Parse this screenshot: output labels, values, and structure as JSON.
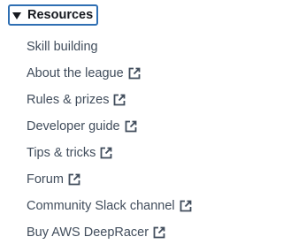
{
  "section": {
    "title": "Resources",
    "expanded": true,
    "caret_icon": "caret-down-icon"
  },
  "links": [
    {
      "label": "Skill building",
      "external": false
    },
    {
      "label": "About the league",
      "external": true
    },
    {
      "label": "Rules & prizes",
      "external": true
    },
    {
      "label": "Developer guide",
      "external": true
    },
    {
      "label": "Tips & tricks",
      "external": true
    },
    {
      "label": "Forum",
      "external": true
    },
    {
      "label": "Community Slack channel",
      "external": true
    },
    {
      "label": "Buy AWS DeepRacer",
      "external": true
    }
  ],
  "external_icon": "external-link-icon",
  "colors": {
    "focus_ring": "#2f6fb3",
    "text_primary": "#16191f",
    "link_text": "#414d5c"
  }
}
